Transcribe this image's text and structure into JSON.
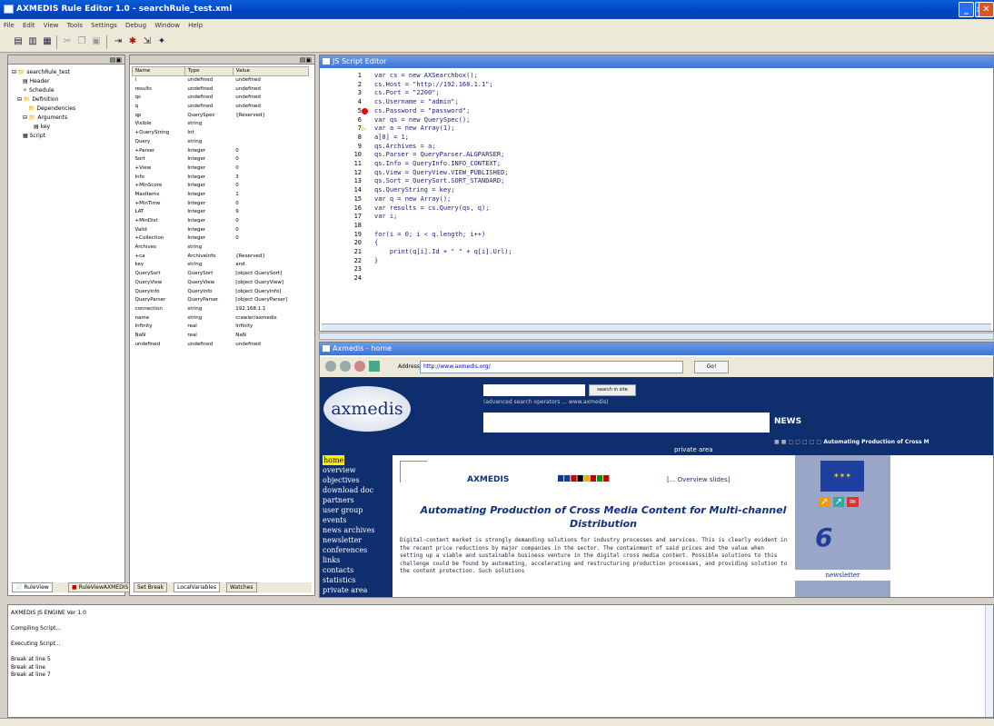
{
  "window": {
    "title": "AXMEDIS Rule Editor 1.0 - searchRule_test.xml"
  },
  "menu": [
    "File",
    "Edit",
    "View",
    "Tools",
    "Settings",
    "Debug",
    "Window",
    "Help"
  ],
  "left_tree": {
    "items": [
      "searchRule_test",
      "Header",
      "Schedule",
      "Definition",
      "Dependencies",
      "Arguments",
      "key",
      "Script"
    ]
  },
  "left_tabs": [
    "RuleView",
    "RuleViewAXMEDIS"
  ],
  "variables": {
    "headers": [
      "Name",
      "Type",
      "Value"
    ],
    "rows": [
      [
        "i",
        "undefined",
        "undefined"
      ],
      [
        "results",
        "undefined",
        "undefined"
      ],
      [
        "qs",
        "undefined",
        "undefined"
      ],
      [
        "q",
        "undefined",
        "undefined"
      ],
      [
        "qp",
        "QuerySpec",
        "{Reserved}"
      ],
      [
        "Visible",
        "string",
        ""
      ],
      [
        "+QueryString",
        "Int",
        ""
      ],
      [
        "Query",
        "string",
        ""
      ],
      [
        "+Parser",
        "Integer",
        "0"
      ],
      [
        "Sort",
        "Integer",
        "0"
      ],
      [
        "+View",
        "Integer",
        "0"
      ],
      [
        "Info",
        "Integer",
        "3"
      ],
      [
        "+MinScore",
        "Integer",
        "0"
      ],
      [
        "MaxItems",
        "Integer",
        "1"
      ],
      [
        "+MinTime",
        "Integer",
        "0"
      ],
      [
        "LAT",
        "Integer",
        "9"
      ],
      [
        "+MinDist",
        "Integer",
        "0"
      ],
      [
        "Valid",
        "Integer",
        "0"
      ],
      [
        "+Collection",
        "Integer",
        "0"
      ],
      [
        "Archives",
        "string",
        ""
      ],
      [
        "+ca",
        "ArchiveInfo",
        "{Reserved}"
      ],
      [
        "key",
        "string",
        "and"
      ],
      [
        "QuerySort",
        "QuerySort",
        "[object QuerySort]"
      ],
      [
        "QueryView",
        "QueryView",
        "[object QueryView]"
      ],
      [
        "QueryInfo",
        "QueryInfo",
        "[object QueryInfo]"
      ],
      [
        "QueryParser",
        "QueryParser",
        "[object QueryParser]"
      ],
      [
        "connection",
        "string",
        "192.168.1.1"
      ],
      [
        "name",
        "string",
        "crawler/axmedis"
      ],
      [
        "Infinity",
        "real",
        "Infinity"
      ],
      [
        "NaN",
        "real",
        "NaN"
      ],
      [
        "undefined",
        "undefined",
        "undefined"
      ]
    ]
  },
  "variable_tabs": [
    "Set Break",
    "LocalVariables",
    "Watches"
  ],
  "script_editor": {
    "title": "JS Script Editor",
    "lines": [
      {
        "n": "1",
        "text": "var cs = new AXSearchbox();",
        "marker": ""
      },
      {
        "n": "2",
        "text": "cs.Host = \"http://192.168.1.1\";",
        "marker": ""
      },
      {
        "n": "3",
        "text": "cs.Port = \"2200\";",
        "marker": ""
      },
      {
        "n": "4",
        "text": "cs.Username = \"admin\";",
        "marker": ""
      },
      {
        "n": "5",
        "text": "cs.Password = \"password\";",
        "marker": "breakpoint"
      },
      {
        "n": "6",
        "text": "var qs = new QuerySpec();",
        "marker": ""
      },
      {
        "n": "7",
        "text": "var a = new Array(1);",
        "marker": "current"
      },
      {
        "n": "8",
        "text": "a[0] = 1;",
        "marker": ""
      },
      {
        "n": "9",
        "text": "qs.Archives = a;",
        "marker": ""
      },
      {
        "n": "10",
        "text": "qs.Parser = QueryParser.ALGPARSER;",
        "marker": ""
      },
      {
        "n": "11",
        "text": "qs.Info = QueryInfo.INFO_CONTEXT;",
        "marker": ""
      },
      {
        "n": "12",
        "text": "qs.View = QueryView.VIEW_PUBLISHED;",
        "marker": ""
      },
      {
        "n": "13",
        "text": "qs.Sort = QuerySort.SORT_STANDARD;",
        "marker": ""
      },
      {
        "n": "14",
        "text": "qs.QueryString = key;",
        "marker": ""
      },
      {
        "n": "15",
        "text": "var q = new Array();",
        "marker": ""
      },
      {
        "n": "16",
        "text": "var results = cs.Query(qs, q);",
        "marker": ""
      },
      {
        "n": "17",
        "text": "var i;",
        "marker": ""
      },
      {
        "n": "18",
        "text": "",
        "marker": ""
      },
      {
        "n": "19",
        "text": "for(i = 0; i < q.length; i++)",
        "marker": ""
      },
      {
        "n": "20",
        "text": "{",
        "marker": ""
      },
      {
        "n": "21",
        "text": "    print(q[i].Id + \" \" + q[i].Url);",
        "marker": ""
      },
      {
        "n": "22",
        "text": "}",
        "marker": ""
      },
      {
        "n": "23",
        "text": "",
        "marker": ""
      },
      {
        "n": "24",
        "text": "",
        "marker": ""
      }
    ]
  },
  "browser": {
    "title": "Axmedis - home",
    "address_label": "Address",
    "address": "http://www.axmedis.org/",
    "go_label": "Go!",
    "logo": "axmedis",
    "search_button": "search in site",
    "advanced": "(advanced search operators ... www.axmedis)",
    "news": "NEWS",
    "private_area": "private area",
    "tagline": "Automating Production of Cross M",
    "nav": [
      "home",
      "overview",
      "objectives",
      "download doc",
      "partners",
      "user group",
      "events",
      "news archives",
      "newsletter",
      "conferences",
      "links",
      "contacts",
      "statistics",
      "private area"
    ],
    "axmedis_title": "AXMEDIS",
    "overview_link": "[... Overview slides]",
    "headline": "Automating Production of Cross Media Content for Multi-channel Distribution",
    "body": "Digital-content market is strongly demanding solutions for industry processes and services. This is clearly evident in the recent price reductions by major companies in the sector. The containment of said prices and the value when setting up a viable and sustainable business venture in the digital cross media content. Possible solutions to this challenge could be found by automating, accelerating and restructuring production processes, and providing solution to the content protection. Such solutions",
    "newsletter": "newsletter"
  },
  "output": {
    "header": "AXMEDIS JS ENGINE Ver 1.0",
    "lines": [
      "Compiling Script...",
      "Executing Script...",
      "Break at line 5",
      "Break at line",
      "Break at line 7"
    ]
  },
  "colors": {
    "title_blue": "#0a5ed7",
    "site_navy": "#0e2e6e",
    "highlight_yellow": "#ffee00"
  }
}
